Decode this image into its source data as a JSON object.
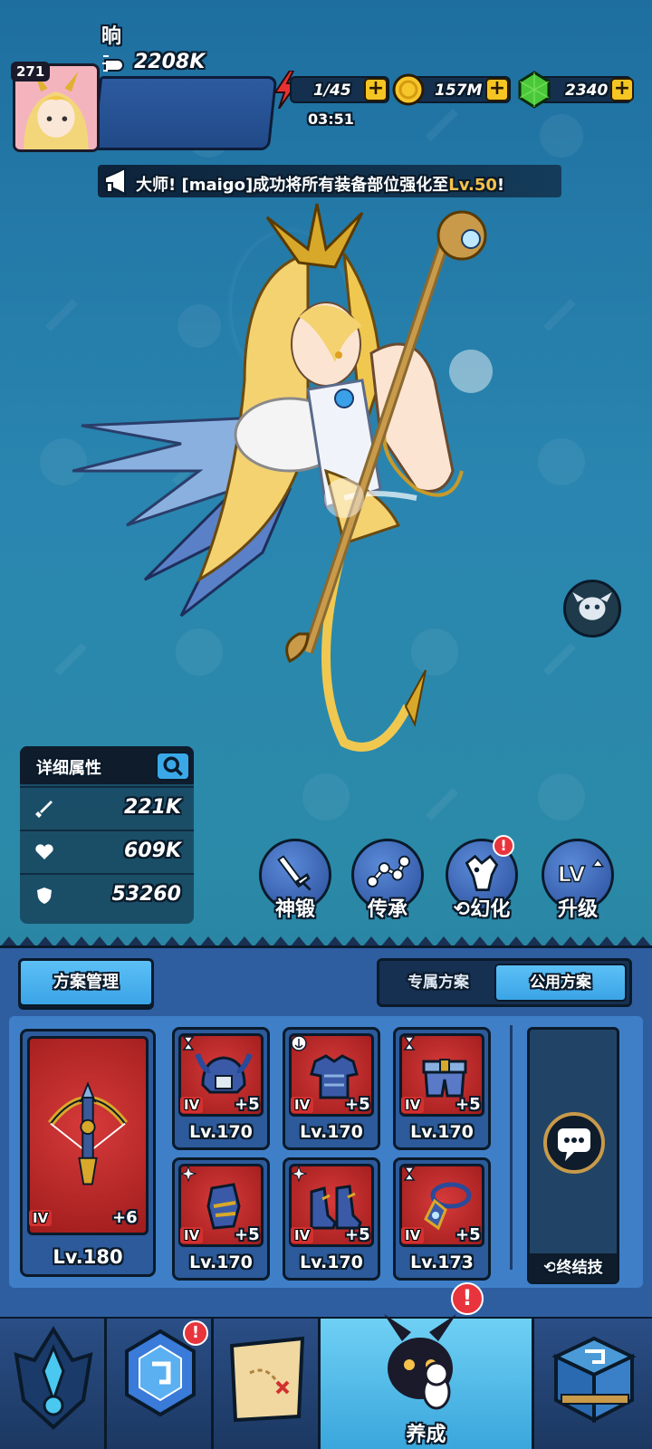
{
  "player": {
    "level": "271",
    "name": "晌",
    "power": "2208K"
  },
  "resources": {
    "stamina": "1/45",
    "stamina_timer": "03:51",
    "gold": "157M",
    "gems": "2340"
  },
  "announcement": {
    "prefix": "大师! [maigo]成功将所有装备部位强化至",
    "highlight": "Lv.50",
    "suffix": "!"
  },
  "attributes": {
    "title": "详细属性",
    "attack": "221K",
    "hp": "609K",
    "defense": "53260"
  },
  "actions": [
    {
      "label": "神锻",
      "icon": "sword-icon"
    },
    {
      "label": "传承",
      "icon": "share-nodes-icon"
    },
    {
      "label": "幻化",
      "icon": "transform-icon",
      "badge": "!"
    },
    {
      "label": "升级",
      "icon": "level-up-icon"
    }
  ],
  "plan": {
    "manage_label": "方案管理",
    "tab_exclusive": "专属方案",
    "tab_public": "公用方案",
    "active_tab": "公用方案"
  },
  "weapon": {
    "tier": "IV",
    "plus": "+6",
    "level": "Lv.180"
  },
  "gear": [
    {
      "name": "helmet",
      "tier": "IV",
      "plus": "+5",
      "level": "Lv.170"
    },
    {
      "name": "armor",
      "tier": "IV",
      "plus": "+5",
      "level": "Lv.170"
    },
    {
      "name": "belt",
      "tier": "IV",
      "plus": "+5",
      "level": "Lv.170"
    },
    {
      "name": "gauntlet",
      "tier": "IV",
      "plus": "+5",
      "level": "Lv.170"
    },
    {
      "name": "boots",
      "tier": "IV",
      "plus": "+5",
      "level": "Lv.170"
    },
    {
      "name": "amulet",
      "tier": "IV",
      "plus": "+5",
      "level": "Lv.173"
    }
  ],
  "ultimate": {
    "label": "终结技"
  },
  "nav": [
    {
      "label": "",
      "icon": "hero-crest-icon"
    },
    {
      "label": "",
      "icon": "dungeon-gem-icon",
      "badge": "!"
    },
    {
      "label": "",
      "icon": "treasure-map-icon"
    },
    {
      "label": "养成",
      "icon": "nurture-character-icon",
      "badge": "!",
      "active": true
    },
    {
      "label": "",
      "icon": "shop-chest-icon"
    }
  ]
}
